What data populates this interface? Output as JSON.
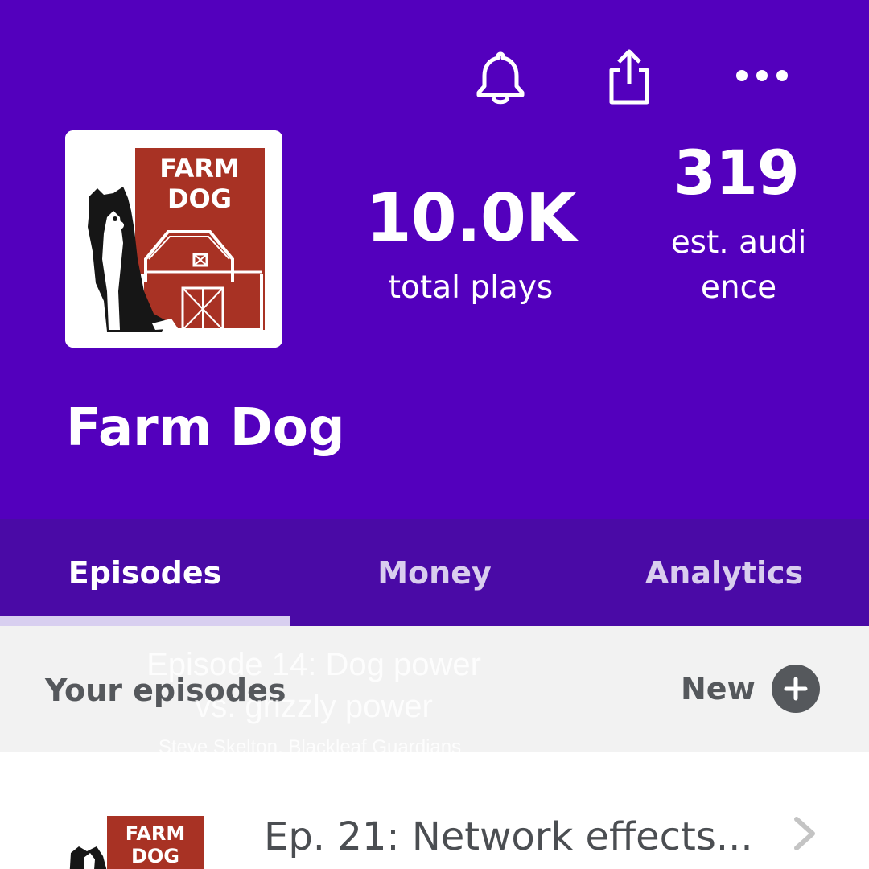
{
  "header": {
    "icons": [
      "bell-icon",
      "share-icon",
      "more-icon"
    ],
    "background_color": "#5300bd"
  },
  "podcast": {
    "title": "Farm Dog",
    "cover_text_line1": "FARM",
    "cover_text_line2": "DOG",
    "cover_color": "#a83224"
  },
  "stats": {
    "plays_value": "10.0K",
    "plays_label": "total plays",
    "audience_value": "319",
    "audience_label": "est. audience"
  },
  "tabs": [
    {
      "label": "Episodes",
      "active": true
    },
    {
      "label": "Money",
      "active": false
    },
    {
      "label": "Analytics",
      "active": false
    }
  ],
  "episodes_section": {
    "title": "Your episodes",
    "new_label": "New"
  },
  "overlay": {
    "title": "Episode 14: Dog power vs. grizzly power",
    "subtitle": "Steve Skelton, Blackleaf Guardians"
  },
  "episode_list": [
    {
      "title": "Ep. 21: Network effects..."
    }
  ],
  "colors": {
    "tab_bar": "#4a0aa6",
    "indicator": "#d8cff0",
    "section_bg": "#f2f2f2",
    "gray_text": "#55585c"
  }
}
